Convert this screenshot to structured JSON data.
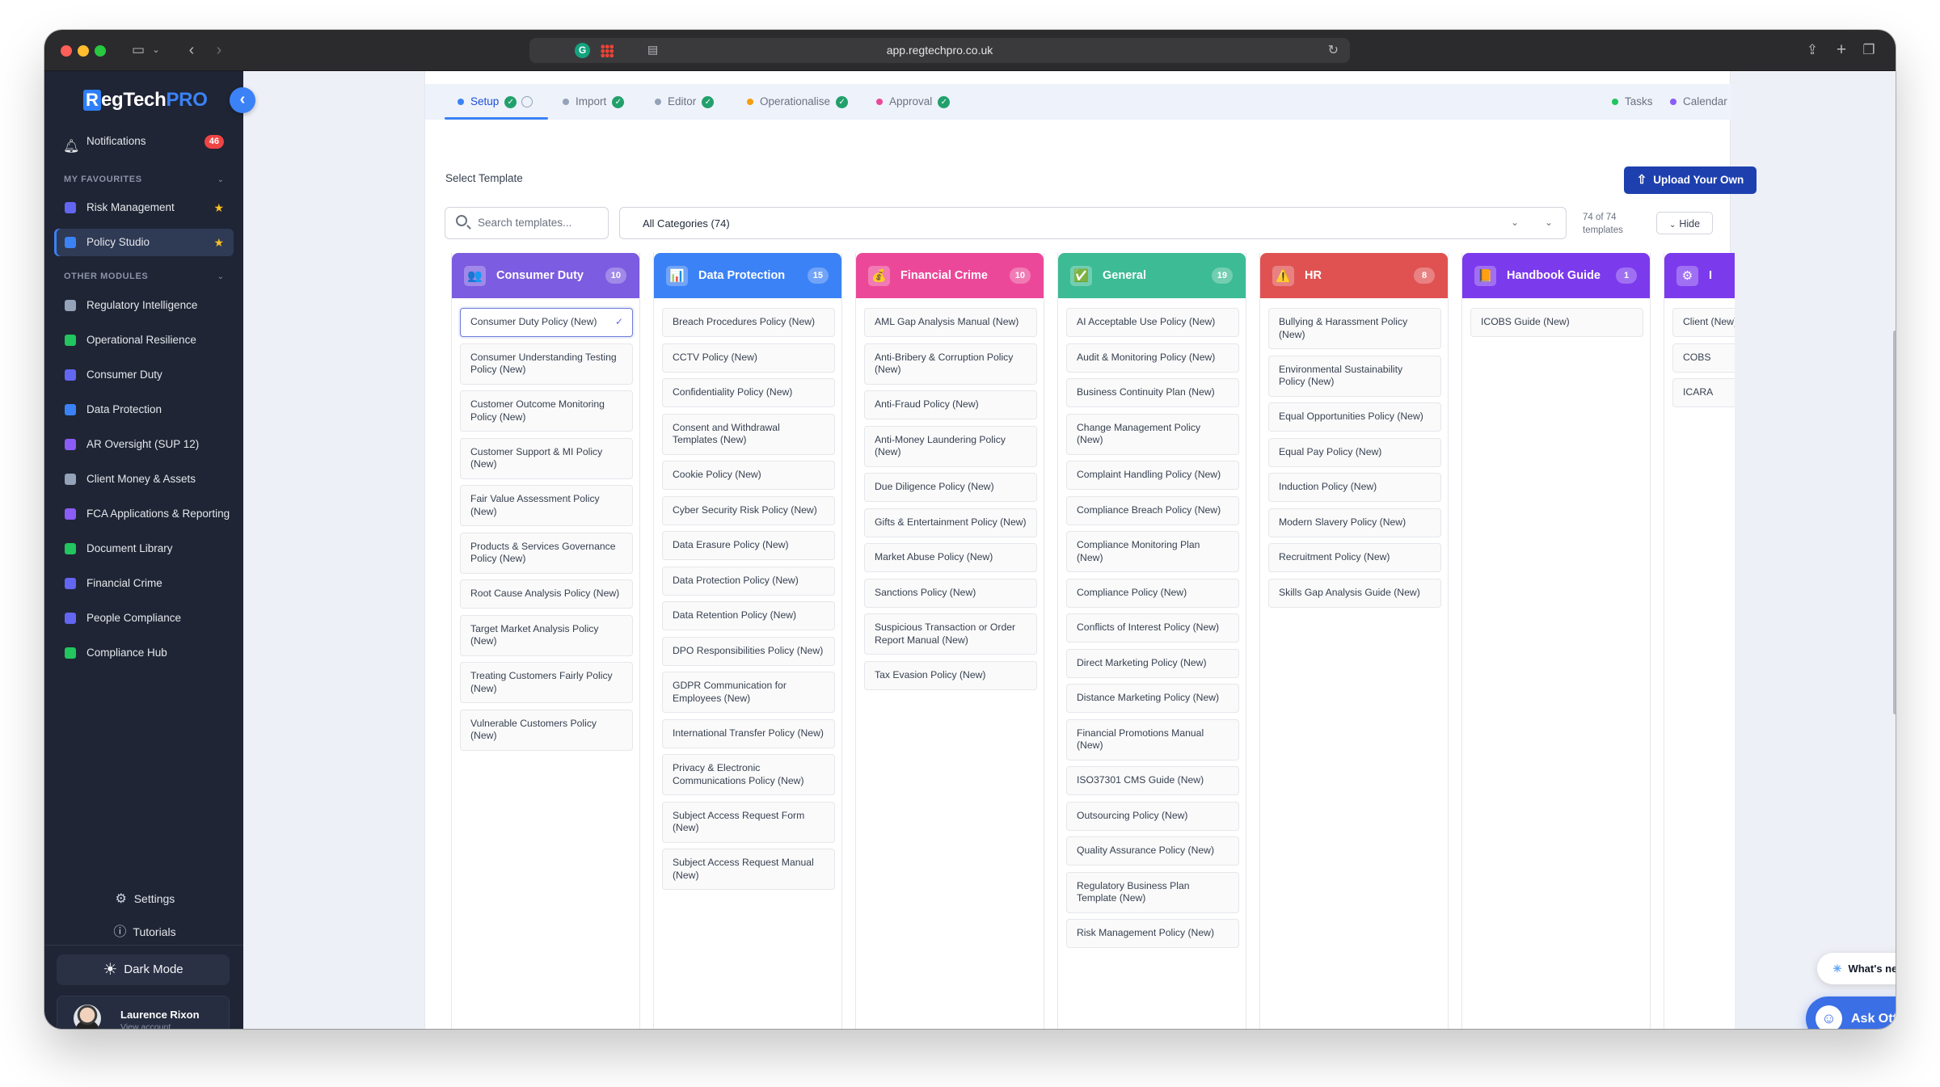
{
  "browser": {
    "url": "app.regtechpro.co.uk"
  },
  "sidebar": {
    "logo_main": "egTech",
    "logo_r": "R",
    "logo_pro": "PRO",
    "notifications": {
      "label": "Notifications",
      "count": "46"
    },
    "favourites_label": "MY FAVOURITES",
    "favourites": [
      {
        "label": "Risk Management",
        "color": "#6366f1"
      },
      {
        "label": "Policy Studio",
        "color": "#3b82f6"
      }
    ],
    "other_label": "OTHER MODULES",
    "modules": [
      {
        "label": "Regulatory Intelligence",
        "color": "#94a3b8"
      },
      {
        "label": "Operational Resilience",
        "color": "#22c55e"
      },
      {
        "label": "Consumer Duty",
        "color": "#6366f1"
      },
      {
        "label": "Data Protection",
        "color": "#3b82f6"
      },
      {
        "label": "AR Oversight (SUP 12)",
        "color": "#8b5cf6"
      },
      {
        "label": "Client Money & Assets",
        "color": "#94a3b8"
      },
      {
        "label": "FCA Applications & Reporting",
        "color": "#8b5cf6"
      },
      {
        "label": "Document Library",
        "color": "#22c55e"
      },
      {
        "label": "Financial Crime",
        "color": "#6366f1"
      },
      {
        "label": "People Compliance",
        "color": "#6366f1"
      },
      {
        "label": "Compliance Hub",
        "color": "#22c55e"
      }
    ],
    "settings": "Settings",
    "tutorials": "Tutorials",
    "dark_mode": "Dark Mode",
    "user": {
      "name": "Laurence Rixon",
      "sub": "View account"
    }
  },
  "steps": [
    {
      "label": "Setup",
      "dot": "#3b82f6"
    },
    {
      "label": "Import",
      "dot": "#94a3b8"
    },
    {
      "label": "Editor",
      "dot": "#94a3b8"
    },
    {
      "label": "Operationalise",
      "dot": "#f59e0b"
    },
    {
      "label": "Approval",
      "dot": "#ec4899"
    }
  ],
  "top_right_links": [
    {
      "label": "Tasks",
      "dot": "#22c55e"
    },
    {
      "label": "Calendar",
      "dot": "#8b5cf6"
    }
  ],
  "select_template": "Select Template",
  "upload_button": "Upload Your Own",
  "search_placeholder": "Search templates...",
  "category_select": "All Categories (74)",
  "template_count": "74 of 74 templates",
  "hide_button": "Hide",
  "columns": [
    {
      "title": "Consumer Duty",
      "count": "10",
      "color": "#7c5ce0",
      "icon": "👥",
      "items": [
        "Consumer Duty Policy (New)",
        "Consumer Understanding Testing Policy (New)",
        "Customer Outcome Monitoring Policy (New)",
        "Customer Support & MI Policy (New)",
        "Fair Value Assessment Policy (New)",
        "Products & Services Governance Policy (New)",
        "Root Cause Analysis Policy (New)",
        "Target Market Analysis Policy (New)",
        "Treating Customers Fairly Policy (New)",
        "Vulnerable Customers Policy (New)"
      ]
    },
    {
      "title": "Data Protection",
      "count": "15",
      "color": "#3b82f6",
      "icon": "📊",
      "items": [
        "Breach Procedures Policy (New)",
        "CCTV Policy (New)",
        "Confidentiality Policy (New)",
        "Consent and Withdrawal Templates (New)",
        "Cookie Policy (New)",
        "Cyber Security Risk Policy (New)",
        "Data Erasure Policy (New)",
        "Data Protection Policy (New)",
        "Data Retention Policy (New)",
        "DPO Responsibilities Policy (New)",
        "GDPR Communication for Employees (New)",
        "International Transfer Policy (New)",
        "Privacy & Electronic Communications Policy (New)",
        "Subject Access Request Form (New)",
        "Subject Access Request Manual (New)"
      ]
    },
    {
      "title": "Financial Crime",
      "count": "10",
      "color": "#ec4899",
      "icon": "💰",
      "items": [
        "AML Gap Analysis Manual (New)",
        "Anti-Bribery & Corruption Policy (New)",
        "Anti-Fraud Policy (New)",
        "Anti-Money Laundering Policy (New)",
        "Due Diligence Policy (New)",
        "Gifts & Entertainment Policy (New)",
        "Market Abuse Policy (New)",
        "Sanctions Policy (New)",
        "Suspicious Transaction or Order Report Manual (New)",
        "Tax Evasion Policy (New)"
      ]
    },
    {
      "title": "General",
      "count": "19",
      "color": "#3dbb94",
      "icon": "✅",
      "items": [
        "AI Acceptable Use Policy (New)",
        "Audit & Monitoring Policy (New)",
        "Business Continuity Plan (New)",
        "Change Management Policy (New)",
        "Complaint Handling Policy (New)",
        "Compliance Breach Policy (New)",
        "Compliance Monitoring Plan (New)",
        "Compliance Policy (New)",
        "Conflicts of Interest Policy (New)",
        "Direct Marketing Policy (New)",
        "Distance Marketing Policy (New)",
        "Financial Promotions Manual (New)",
        "ISO37301 CMS Guide (New)",
        "Outsourcing Policy (New)",
        "Quality Assurance Policy (New)",
        "Regulatory Business Plan Template (New)",
        "Risk Management Policy (New)"
      ]
    },
    {
      "title": "HR",
      "count": "8",
      "color": "#e05252",
      "icon": "⚠️",
      "items": [
        "Bullying & Harassment Policy (New)",
        "Environmental Sustainability Policy (New)",
        "Equal Opportunities Policy (New)",
        "Equal Pay Policy (New)",
        "Induction Policy (New)",
        "Modern Slavery Policy (New)",
        "Recruitment Policy (New)",
        "Skills Gap Analysis Guide (New)"
      ]
    },
    {
      "title": "Handbook Guide",
      "count": "1",
      "color": "#7c3aed",
      "icon": "📙",
      "items": [
        "ICOBS Guide (New)"
      ]
    },
    {
      "title": "I",
      "count": "",
      "color": "#7c3aed",
      "icon": "⚙",
      "items": [
        "Client (New)",
        "COBS",
        "ICARA"
      ]
    }
  ],
  "whats_new": "What's new",
  "ask_otto": "Ask Otto"
}
